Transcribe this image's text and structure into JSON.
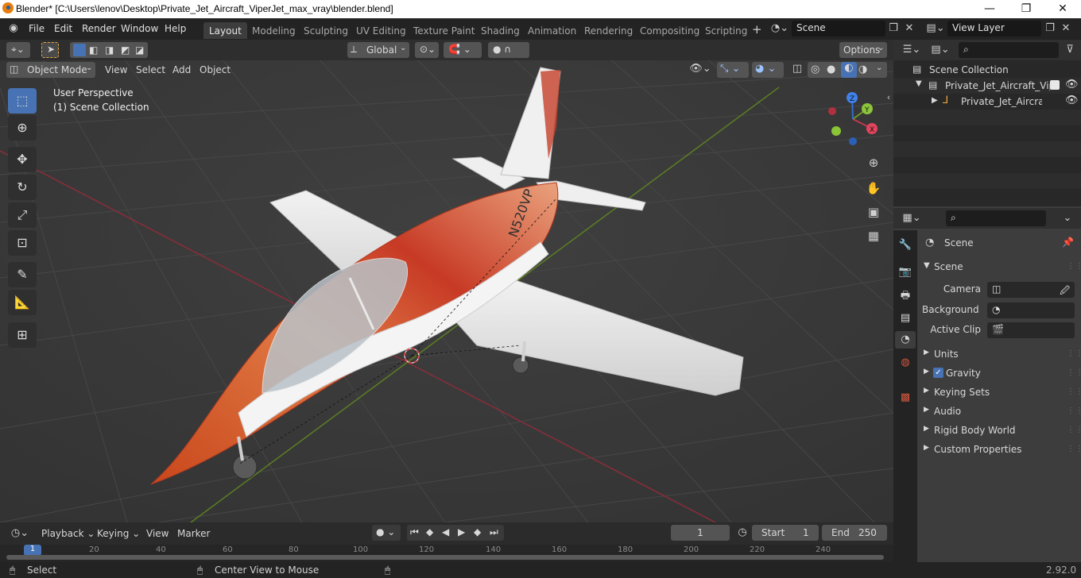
{
  "window": {
    "title": "Blender* [C:\\Users\\lenov\\Desktop\\Private_Jet_Aircraft_ViperJet_max_vray\\blender.blend]",
    "minimize": "—",
    "maximize": "❐",
    "close": "✕"
  },
  "menu": {
    "items": [
      "File",
      "Edit",
      "Render",
      "Window",
      "Help"
    ],
    "workspaces": [
      "Layout",
      "Modeling",
      "Sculpting",
      "UV Editing",
      "Texture Paint",
      "Shading",
      "Animation",
      "Rendering",
      "Compositing",
      "Scripting"
    ],
    "add_tab": "+",
    "scene_label": "Scene",
    "view_layer_label": "View Layer"
  },
  "viewport_header": {
    "mode": "Object Mode",
    "menus": [
      "View",
      "Select",
      "Add",
      "Object"
    ],
    "transform_orientation": "Global",
    "options": "Options"
  },
  "viewport": {
    "perspective": "User Perspective",
    "collection": "(1) Scene Collection",
    "gizmo": {
      "x": "X",
      "y": "Y",
      "z": "Z"
    },
    "model_text": "N520VP"
  },
  "outliner": {
    "scene_collection": "Scene Collection",
    "collection": "Private_Jet_Aircraft_Vipe",
    "object": "Private_Jet_Aircraft_'"
  },
  "properties": {
    "header": "Scene",
    "panel": "Scene",
    "camera_label": "Camera",
    "background_label": "Background ...",
    "active_clip_label": "Active Clip",
    "sections": [
      "Units",
      "Gravity",
      "Keying Sets",
      "Audio",
      "Rigid Body World",
      "Custom Properties"
    ],
    "gravity_checked": true
  },
  "timeline": {
    "menus": [
      "Playback",
      "Keying",
      "View",
      "Marker"
    ],
    "current_frame": "1",
    "start_label": "Start",
    "start_value": "1",
    "end_label": "End",
    "end_value": "250",
    "ruler": [
      "1",
      "20",
      "40",
      "60",
      "80",
      "100",
      "120",
      "140",
      "160",
      "180",
      "200",
      "220",
      "240"
    ]
  },
  "status": {
    "select": "Select",
    "center": "Center View to Mouse",
    "version": "2.92.0"
  },
  "colors": {
    "accent": "#4772b3",
    "x_axis": "#c2374f",
    "y_axis": "#6f9b23",
    "z_axis": "#2f6fd3"
  }
}
